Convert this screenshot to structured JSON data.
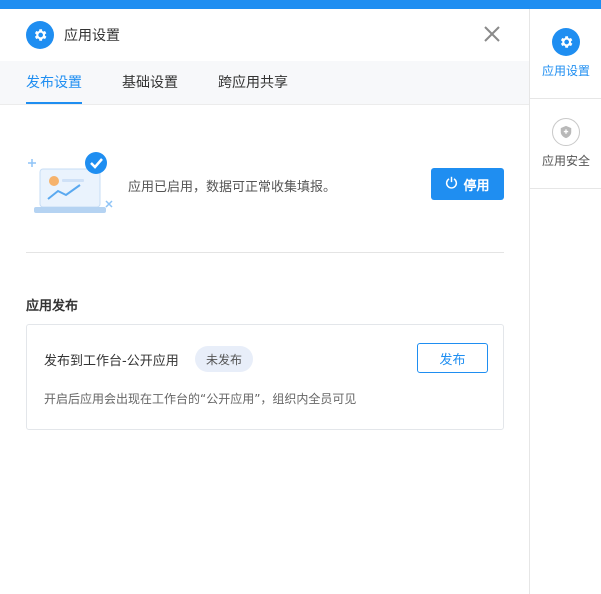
{
  "header": {
    "title": "应用设置",
    "gear_icon": "gear-icon",
    "close_icon": "close-icon"
  },
  "tabs": [
    {
      "label": "发布设置",
      "active": true
    },
    {
      "label": "基础设置",
      "active": false
    },
    {
      "label": "跨应用共享",
      "active": false
    }
  ],
  "status": {
    "text": "应用已启用，数据可正常收集填报。",
    "button_label": "停用",
    "button_icon": "power-icon"
  },
  "publish": {
    "section_title": "应用发布",
    "card_title": "发布到工作台-公开应用",
    "badge": "未发布",
    "button_label": "发布",
    "description": "开启后应用会出现在工作台的“公开应用”，组织内全员可见"
  },
  "rail": [
    {
      "label": "应用设置",
      "icon": "gear-icon",
      "active": true
    },
    {
      "label": "应用安全",
      "icon": "shield-icon",
      "active": false
    }
  ],
  "colors": {
    "accent": "#1f8ef1",
    "badge_bg": "#e8eef9",
    "divider": "#e4e4e4"
  }
}
